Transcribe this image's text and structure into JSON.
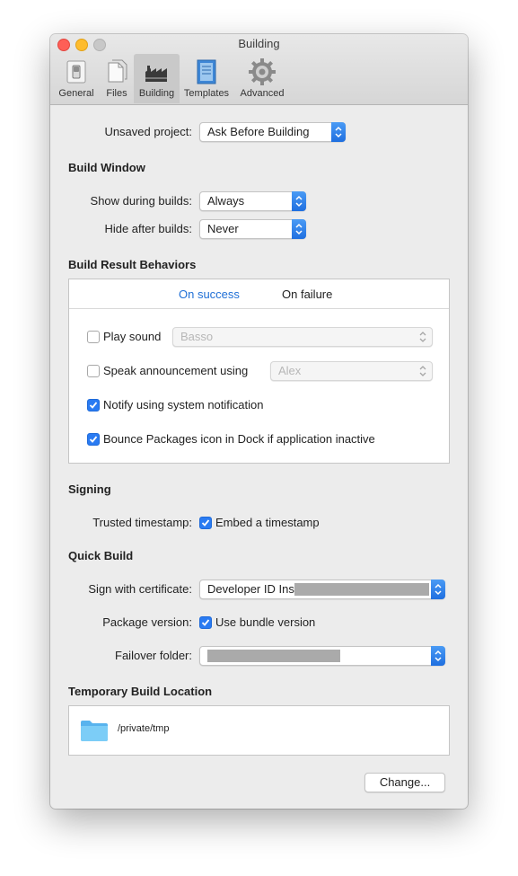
{
  "window": {
    "title": "Building"
  },
  "toolbar": {
    "items": [
      {
        "label": "General",
        "icon": "switch-icon"
      },
      {
        "label": "Files",
        "icon": "files-icon"
      },
      {
        "label": "Building",
        "icon": "factory-icon",
        "selected": true
      },
      {
        "label": "Templates",
        "icon": "template-icon"
      },
      {
        "label": "Advanced",
        "icon": "gear-icon"
      }
    ]
  },
  "unsaved_project": {
    "label": "Unsaved project:",
    "value": "Ask Before Building"
  },
  "build_window": {
    "heading": "Build Window",
    "show_label": "Show during builds:",
    "show_value": "Always",
    "hide_label": "Hide after builds:",
    "hide_value": "Never"
  },
  "build_result": {
    "heading": "Build Result Behaviors",
    "tabs": [
      "On success",
      "On failure"
    ],
    "active_tab": "On success",
    "play_sound": {
      "label": "Play sound",
      "checked": false,
      "value": "Basso"
    },
    "speak": {
      "label": "Speak announcement using",
      "checked": false,
      "value": "Alex"
    },
    "notify": {
      "label": "Notify using system notification",
      "checked": true
    },
    "bounce": {
      "label": "Bounce Packages icon in Dock if application inactive",
      "checked": true
    }
  },
  "signing": {
    "heading": "Signing",
    "timestamp_label": "Trusted timestamp:",
    "timestamp_checkbox": "Embed a timestamp",
    "checked": true
  },
  "quick_build": {
    "heading": "Quick Build",
    "cert_label": "Sign with certificate:",
    "cert_value": "Developer ID Ins",
    "version_label": "Package version:",
    "version_checkbox": "Use bundle version",
    "version_checked": true,
    "failover_label": "Failover folder:"
  },
  "temp_location": {
    "heading": "Temporary Build Location",
    "path": "/private/tmp",
    "change_button": "Change..."
  },
  "colors": {
    "accent": "#2a7bf2",
    "tab_active": "#1f6fd6",
    "folder": "#6cc3f5"
  }
}
